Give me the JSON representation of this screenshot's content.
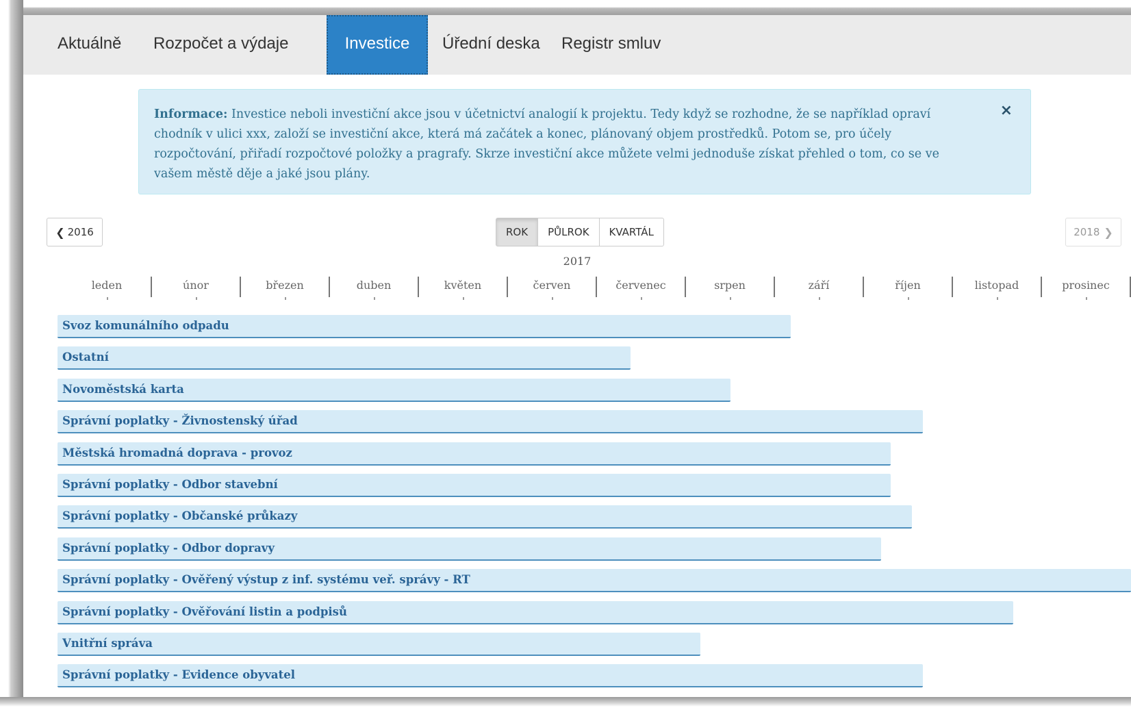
{
  "nav": {
    "tabs": [
      {
        "label": "Aktuálně",
        "active": false
      },
      {
        "label": "Rozpočet a výdaje",
        "active": false
      },
      {
        "label": "Investice",
        "active": true
      },
      {
        "label": "Úřední deska",
        "active": false
      },
      {
        "label": "Registr smluv",
        "active": false
      }
    ],
    "active_color": "#2c82c7"
  },
  "alert": {
    "title": "Informace:",
    "text": "Investice neboli investiční akce jsou v účetnictví analogií k projektu. Tedy když se rozhodne, že se například opraví chodník v ulici xxx, založí se investiční akce, která má začátek a konec, plánovaný objem prostředků. Potom se, pro účely rozpočtování, přiřadí rozpočtové položky a pragrafy. Skrze investiční akce můžete velmi jednoduše získat přehled o tom, co se ve vašem městě děje a jaké jsou plány.",
    "close_symbol": "×"
  },
  "controls": {
    "prev_label": "2016",
    "next_label": "2018",
    "prev_icon": "chevron-left-icon",
    "next_icon": "chevron-right-icon",
    "views": [
      {
        "label": "ROK",
        "active": true
      },
      {
        "label": "PŮLROK",
        "active": false
      },
      {
        "label": "KVARTÁL",
        "active": false
      }
    ]
  },
  "timeline": {
    "year": "2017",
    "months": [
      "leden",
      "únor",
      "březen",
      "duben",
      "květen",
      "červen",
      "červenec",
      "srpen",
      "září",
      "říjen",
      "listopad",
      "prosinec"
    ]
  },
  "rows": [
    {
      "label": "Svoz komunálního odpadu",
      "end_fraction": 0.683
    },
    {
      "label": "Ostatní",
      "end_fraction": 0.534
    },
    {
      "label": "Novoměstská karta",
      "end_fraction": 0.627
    },
    {
      "label": "Správní poplatky - Živnostenský úřad",
      "end_fraction": 0.806
    },
    {
      "label": "Městská hromadná doprava - provoz",
      "end_fraction": 0.776
    },
    {
      "label": "Správní poplatky - Odbor stavební",
      "end_fraction": 0.776
    },
    {
      "label": "Správní poplatky - Občanské průkazy",
      "end_fraction": 0.796
    },
    {
      "label": "Správní poplatky - Odbor dopravy",
      "end_fraction": 0.767
    },
    {
      "label": "Správní poplatky - Ověřený výstup z inf. systému veř. správy - RT",
      "end_fraction": 1.0
    },
    {
      "label": "Správní poplatky - Ověřování listin a podpisů",
      "end_fraction": 0.89
    },
    {
      "label": "Vnitřní správa",
      "end_fraction": 0.599
    },
    {
      "label": "Správní poplatky - Evidence obyvatel",
      "end_fraction": 0.806
    }
  ],
  "colors": {
    "bar_fill": "#d6ebf7",
    "bar_border": "#4d8fbd",
    "bar_text": "#2a6496",
    "alert_bg": "#d9edf7"
  }
}
